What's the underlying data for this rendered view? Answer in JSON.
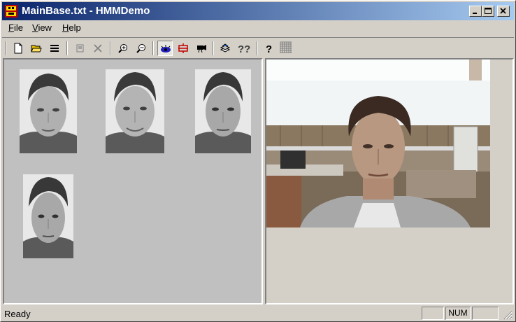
{
  "window": {
    "title": "MainBase.txt - HMMDemo"
  },
  "menu": {
    "file": "F",
    "file_rest": "ile",
    "view": "V",
    "view_rest": "iew",
    "help": "H",
    "help_rest": "elp"
  },
  "toolbar": {
    "buttons": [
      "new-file-icon",
      "open-folder-icon",
      "list-icon",
      "import-image-icon",
      "delete-icon",
      "zoom-in-icon",
      "zoom-out-icon",
      "eye-icon",
      "split-icon",
      "camera-icon",
      "database-icon",
      "question-pair-icon",
      "help-icon",
      "grid-icon"
    ]
  },
  "status": {
    "text": "Ready",
    "caps": "",
    "num": "NUM",
    "scrl": ""
  },
  "colors": {
    "title_start": "#0a246a",
    "title_end": "#a6caf0",
    "face_bg": "#c0c0c0"
  }
}
